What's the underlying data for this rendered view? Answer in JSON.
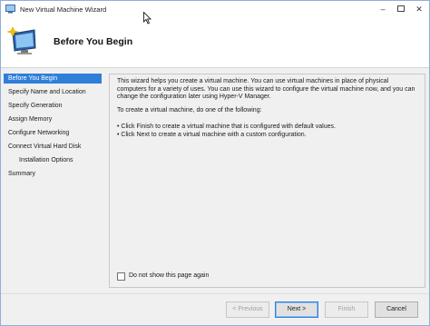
{
  "window": {
    "title": "New Virtual Machine Wizard",
    "title_icon": "hyper-v-vm-icon",
    "controls": [
      "minimize",
      "maximize",
      "close"
    ]
  },
  "header": {
    "icon": "virtual-machine-icon",
    "title": "Before You Begin"
  },
  "nav": {
    "items": [
      {
        "label": "Before You Begin",
        "active": true
      },
      {
        "label": "Specify Name and Location",
        "active": false
      },
      {
        "label": "Specify Generation",
        "active": false
      },
      {
        "label": "Assign Memory",
        "active": false
      },
      {
        "label": "Configure Networking",
        "active": false
      },
      {
        "label": "Connect Virtual Hard Disk",
        "active": false
      },
      {
        "label": "Installation Options",
        "active": false
      },
      {
        "label": "Summary",
        "active": false
      }
    ]
  },
  "content": {
    "intro": "This wizard helps you create a virtual machine. You can use virtual machines in place of physical computers for a variety of uses. You can use this wizard to configure the virtual machine now, and you can change the configuration later using Hyper-V Manager.",
    "prompt": "To create a virtual machine, do one of the following:",
    "bullets": [
      "• Click Finish to create a virtual machine that is configured with default values.",
      "• Click Next to create a virtual machine with a custom configuration."
    ],
    "checkbox_label": "Do not show this page again",
    "checkbox_checked": false
  },
  "footer": {
    "previous": "< Previous",
    "next": "Next >",
    "finish": "Finish",
    "cancel": "Cancel"
  },
  "colors": {
    "accent": "#2f7fd9",
    "panel": "#f0f0f0"
  }
}
